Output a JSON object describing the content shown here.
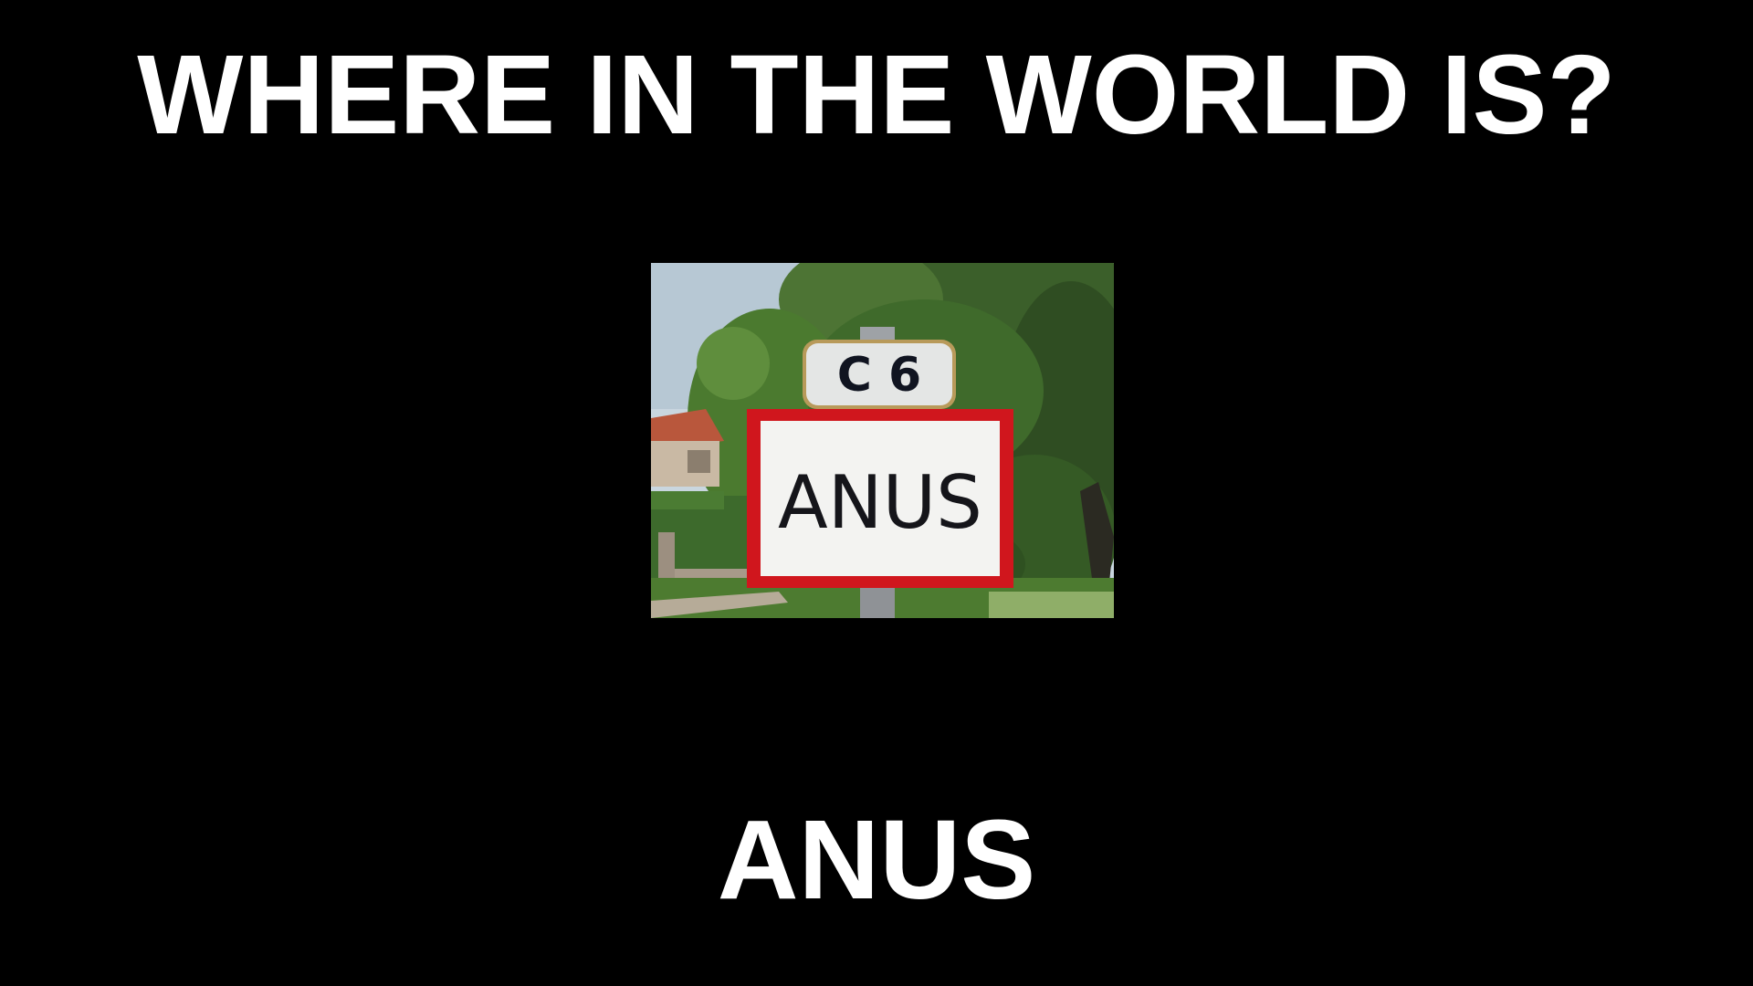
{
  "slide": {
    "question": "WHERE IN THE WORLD IS?",
    "answer": "ANUS"
  },
  "photo": {
    "route_sign_text": "C 6",
    "town_sign_text": "ANUS"
  },
  "colors": {
    "background": "#000000",
    "text": "#ffffff",
    "sign_border": "#d0161d"
  }
}
